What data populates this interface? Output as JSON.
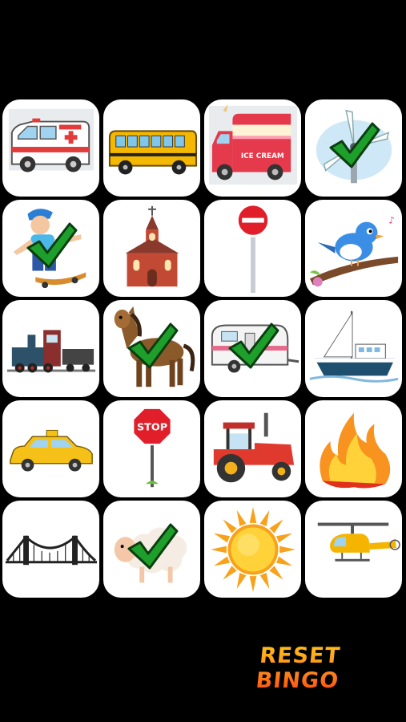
{
  "board": {
    "tiles": [
      {
        "item": "ambulance",
        "checked": false
      },
      {
        "item": "school-bus",
        "checked": false
      },
      {
        "item": "ice-cream-truck",
        "checked": false,
        "sign_text": "ICE CREAM"
      },
      {
        "item": "windmill",
        "checked": true
      },
      {
        "item": "skateboarder",
        "checked": true
      },
      {
        "item": "church",
        "checked": false
      },
      {
        "item": "no-entry-sign",
        "checked": false
      },
      {
        "item": "bird",
        "checked": false
      },
      {
        "item": "train",
        "checked": false
      },
      {
        "item": "horse",
        "checked": true
      },
      {
        "item": "camper-trailer",
        "checked": true
      },
      {
        "item": "boat",
        "checked": false
      },
      {
        "item": "taxi",
        "checked": false
      },
      {
        "item": "stop-sign",
        "checked": false,
        "sign_text": "STOP"
      },
      {
        "item": "tractor",
        "checked": false
      },
      {
        "item": "fire",
        "checked": false
      },
      {
        "item": "bridge",
        "checked": false
      },
      {
        "item": "sheep",
        "checked": true
      },
      {
        "item": "sun",
        "checked": false
      },
      {
        "item": "helicopter",
        "checked": false
      }
    ]
  },
  "reset_button": {
    "line1": "RESET",
    "line2": "BINGO"
  },
  "colors": {
    "background": "#000000",
    "tile": "#ffffff",
    "check_fill": "#1e9e2a",
    "check_outline": "#0a3d10",
    "reset_top": "#ffc21a",
    "reset_bottom": "#ff4a0a"
  }
}
